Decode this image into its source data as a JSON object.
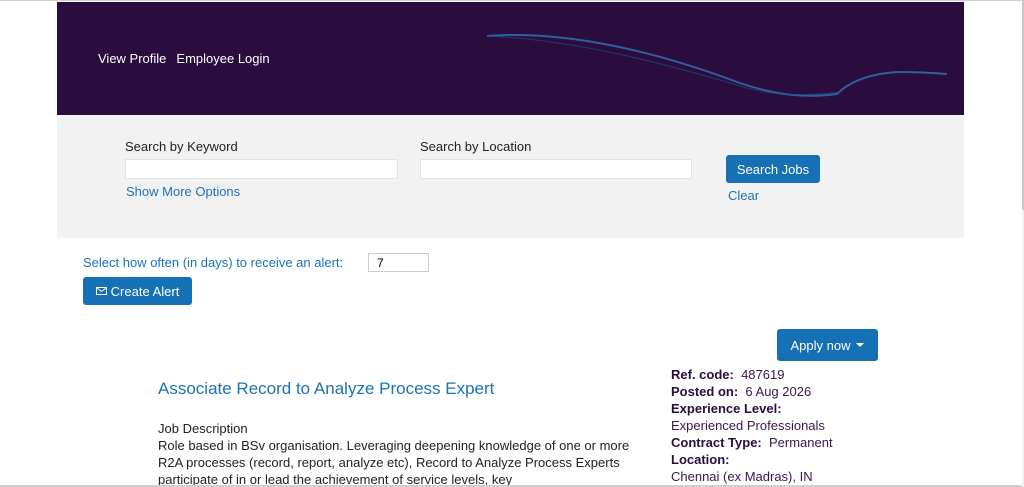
{
  "header": {
    "nav": [
      "View Profile",
      "Employee Login"
    ],
    "background": "#2a0c3f"
  },
  "search": {
    "keyword_label": "Search by Keyword",
    "keyword_value": "",
    "location_label": "Search by Location",
    "location_value": "",
    "more_options": "Show More Options",
    "search_button": "Search Jobs",
    "clear_link": "Clear"
  },
  "alert": {
    "label": "Select how often (in days) to receive an alert:",
    "days_value": "7",
    "create_button": "Create Alert",
    "icon": "envelope-icon"
  },
  "job": {
    "apply_button": "Apply now",
    "title": "Associate Record to Analyze Process Expert",
    "description_heading": "Job Description",
    "description_body": "Role based in BSv organisation. Leveraging deepening knowledge of one or more R2A processes (record, report, analyze etc), Record to Analyze Process Experts participate of in or lead the achievement of service levels, key",
    "ref_code_label": "Ref. code:",
    "ref_code": "487619",
    "posted_on_label": "Posted on:",
    "posted_on": "6 Aug 2026",
    "experience_label": "Experience Level:",
    "experience": "Experienced Professionals",
    "contract_label": "Contract Type:",
    "contract": "Permanent",
    "location_label": "Location:",
    "location": "Chennai (ex Madras), IN"
  },
  "colors": {
    "accent": "#1570b5",
    "link": "#1a73b8",
    "header": "#2a0c3f",
    "band": "#f2f2f2"
  }
}
